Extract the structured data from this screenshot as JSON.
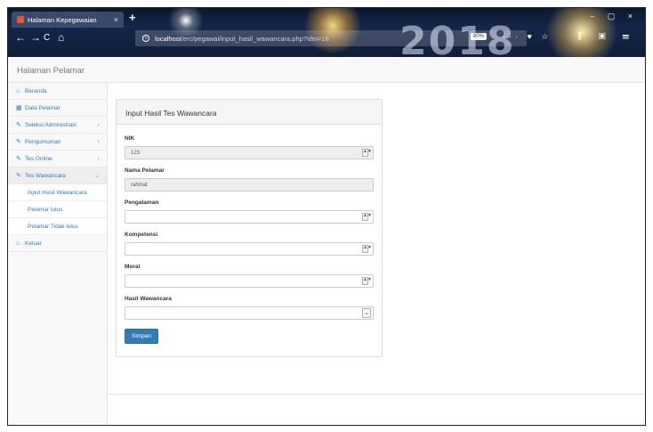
{
  "browser": {
    "tab_title": "Halaman Kepegawaian",
    "tab_close": "×",
    "new_tab": "+",
    "window_controls": "–  ▢  ×",
    "url_host": "localhost",
    "url_path": "/erc/pegawai/input_hasil_wawancara.php?idm=16",
    "zoom": "80%",
    "url_icons": "··· ♥ ☆",
    "toolbar_icons": "⫼ ▣ ☰",
    "banner_text": "2018",
    "nav_back": "←",
    "nav_forward": "→",
    "nav_reload": "C",
    "nav_home": "⌂"
  },
  "app": {
    "header_title": "Halaman Pelamar"
  },
  "sidebar": {
    "items": [
      {
        "label": "Beranda",
        "icon": "home-icon",
        "glyph": "⌂",
        "caret": ""
      },
      {
        "label": "Data Pelamar",
        "icon": "table-icon",
        "glyph": "▦",
        "caret": ""
      },
      {
        "label": "Seleksi Administrasi",
        "icon": "wrench-icon",
        "glyph": "✎",
        "caret": "‹"
      },
      {
        "label": "Pengumuman",
        "icon": "wrench-icon",
        "glyph": "✎",
        "caret": "‹"
      },
      {
        "label": "Tes Online",
        "icon": "wrench-icon",
        "glyph": "✎",
        "caret": "‹"
      },
      {
        "label": "Tes Wawancara",
        "icon": "wrench-icon",
        "glyph": "✎",
        "caret": "⌄"
      }
    ],
    "subitems": [
      {
        "label": "Input Hasil Wawancara"
      },
      {
        "label": "Pelamar lulus"
      },
      {
        "label": "Pelamar Tidak lulus"
      }
    ],
    "logout": {
      "label": "Keluar",
      "icon": "logout-icon",
      "glyph": "⌂"
    }
  },
  "form": {
    "title": "Input Hasil Tes Wawancara",
    "nik_label": "NIK",
    "nik_value": "123",
    "nama_label": "Nama Pelamar",
    "nama_value": "rahmat",
    "pengalaman_label": "Pengalaman",
    "pengalaman_value": "",
    "kompetensi_label": "Kompetensi",
    "kompetensi_value": "",
    "moral_label": "Moral",
    "moral_value": "",
    "hasil_label": "Hasil Wawancara",
    "hasil_value": "",
    "submit_label": "Simpan",
    "spin_glyph": "▲▼",
    "select_glyph": "⌄"
  },
  "colors": {
    "link": "#337ab7",
    "button": "#337ab7",
    "chrome_bg": "#14264a"
  }
}
